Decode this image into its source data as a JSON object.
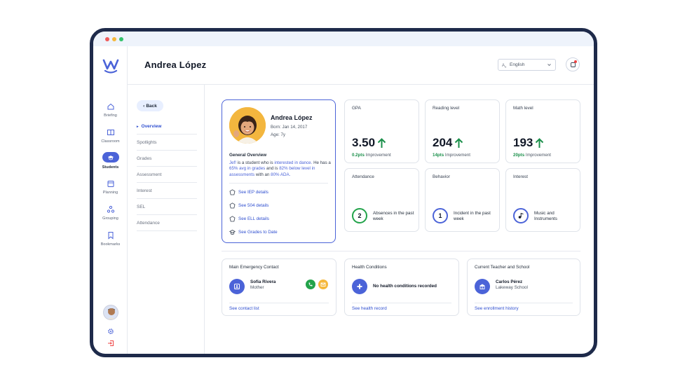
{
  "header": {
    "title": "Andrea López",
    "language": "English"
  },
  "sidebar": {
    "items": [
      {
        "label": "Briefing",
        "icon": "home-icon"
      },
      {
        "label": "Classroom",
        "icon": "classroom-icon"
      },
      {
        "label": "Students",
        "icon": "students-icon",
        "active": true
      },
      {
        "label": "Planning",
        "icon": "calendar-icon"
      },
      {
        "label": "Grouping",
        "icon": "grouping-icon"
      },
      {
        "label": "Bookmarks",
        "icon": "bookmark-icon"
      }
    ]
  },
  "subnav": {
    "back": "Back",
    "items": [
      "Overview",
      "Spotlights",
      "Grades",
      "Assessment",
      "Interest",
      "SEL",
      "Attendance"
    ]
  },
  "profile": {
    "name": "Andrea López",
    "born": "Born: Jan 14, 2017",
    "age": "Age: 7y",
    "overview_title": "General Overview",
    "overview": {
      "p1": "Jef! ",
      "p2": "is a student who is ",
      "p3": "interested in dance.",
      "p4": " He has a ",
      "p5": "65% avg in grades",
      "p6": " and is ",
      "p7": "82% below level in assessments",
      "p8": " with an ",
      "p9": "80% ADA."
    },
    "links": [
      "See IEP details",
      "See 504 details",
      "See ELL details",
      "See Grades to Date"
    ]
  },
  "stats": {
    "gpa": {
      "label": "GPA",
      "value": "3.50",
      "delta": "0.2pts",
      "delta_suffix": " Improvement"
    },
    "reading": {
      "label": "Reading level",
      "value": "204",
      "delta": "14pts",
      "delta_suffix": " Improvement"
    },
    "math": {
      "label": "Math level",
      "value": "193",
      "delta": "20pts",
      "delta_suffix": " Improvement"
    },
    "attendance": {
      "label": "Attendance",
      "count": "2",
      "text": "Absences in the past week",
      "color": "#22a34a"
    },
    "behavior": {
      "label": "Behavior",
      "count": "1",
      "text": "Incident in the past week",
      "color": "#4b63d8"
    },
    "interest": {
      "label": "Interest",
      "text": "Music and Instruments",
      "color": "#4b63d8"
    }
  },
  "bottom": {
    "emergency": {
      "label": "Main Emergency Contact",
      "name": "Sofia Rivera",
      "relation": "Mother",
      "link": "See contact list"
    },
    "health": {
      "label": "Health Conditions",
      "text": "No health conditions recorded",
      "link": "See health record"
    },
    "teacher": {
      "label": "Current Teacher and School",
      "name": "Carlos Pérez",
      "school": "Lakeway School",
      "link": "See enrollment history"
    }
  },
  "colors": {
    "accent": "#4b63d8",
    "success": "#22a34a",
    "phone": "#22a34a",
    "email": "#f5b83c",
    "frame": "#1e2a4a"
  }
}
